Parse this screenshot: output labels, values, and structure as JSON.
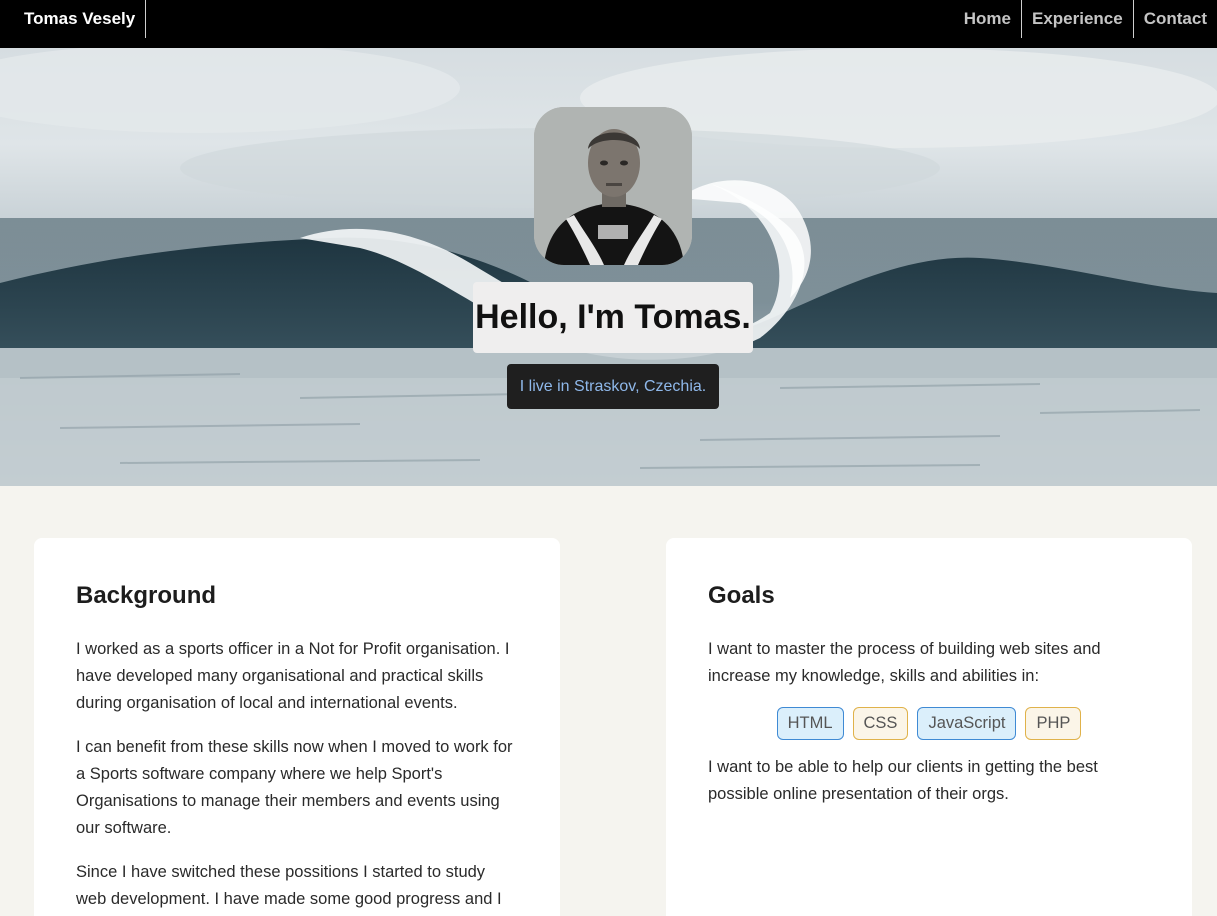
{
  "nav": {
    "brand": "Tomas Vesely",
    "links": [
      "Home",
      "Experience",
      "Contact"
    ]
  },
  "hero": {
    "greeting": "Hello, I'm Tomas.",
    "location": "I live in Straskov, Czechia."
  },
  "background": {
    "title": "Background",
    "paragraphs": [
      "I worked as a sports officer in a Not for Profit organisation. I have developed many organisational and practical skills during organisation of local and international events.",
      "I can benefit from these skills now when I moved to work for a Sports software company where we help Sport's Organisations to manage their members and events using our software.",
      "Since I have switched these possitions I started to study web development. I have made some good progress and I"
    ]
  },
  "goals": {
    "title": "Goals",
    "intro": "I want to master the process of building web sites and increase my knowledge, skills and abilities in:",
    "skills": [
      "HTML",
      "CSS",
      "JavaScript",
      "PHP"
    ],
    "outro": "I want to be able to help our clients in getting the best possible online presentation of their orgs."
  },
  "colors": {
    "nav_bg": "#000000",
    "page_bg": "#f5f4ef",
    "location_text": "#8fb8ea",
    "chip_blue_border": "#3f8ad4",
    "chip_gold_border": "#e0b24a"
  }
}
